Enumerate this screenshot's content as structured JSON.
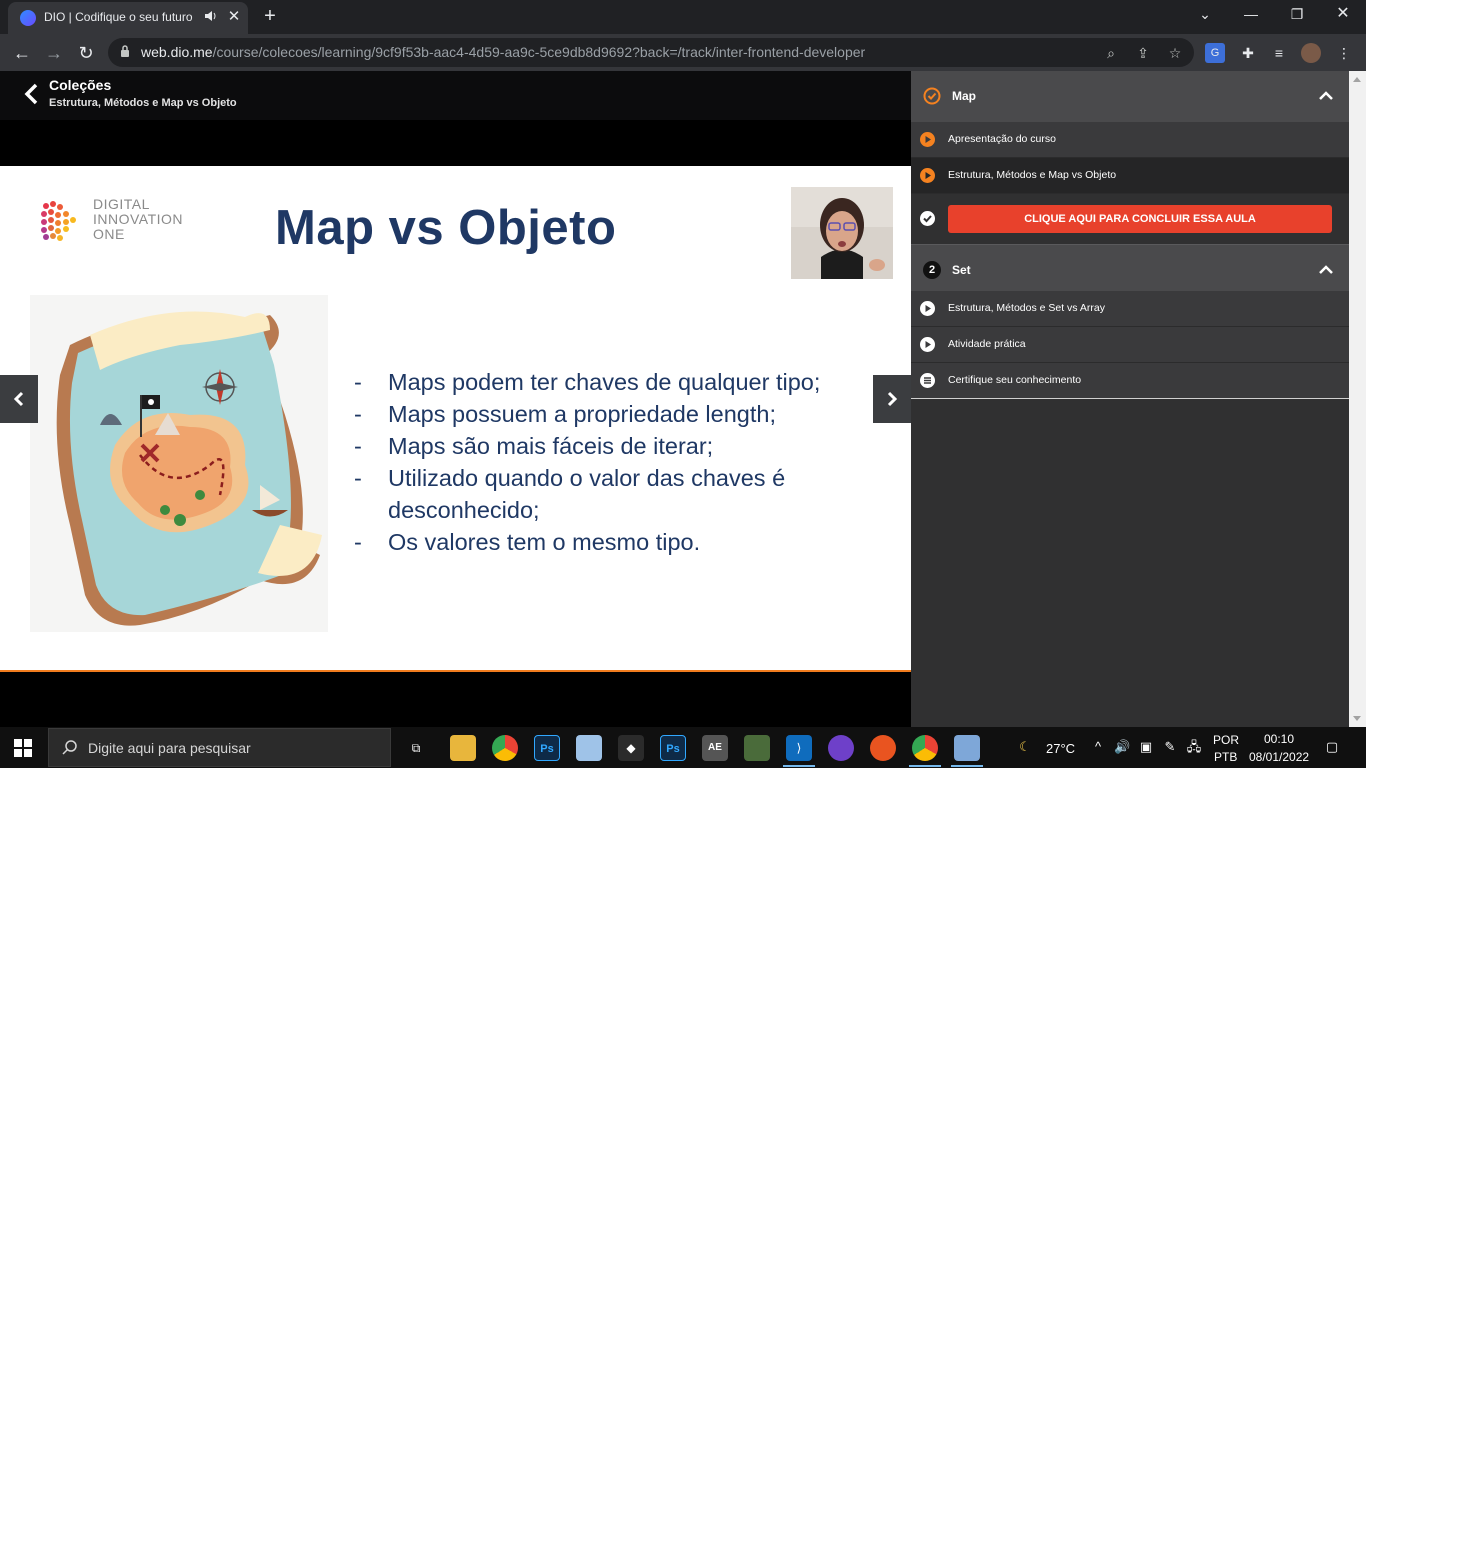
{
  "browser": {
    "tab_title": "DIO | Codifique o seu futuro",
    "url_host": "web.dio.me",
    "url_path": "/course/colecoes/learning/9cf9f53b-aac4-4d59-aa9c-5ce9db8d9692?back=/track/inter-frontend-developer"
  },
  "course_header": {
    "title": "Coleções",
    "subtitle": "Estrutura, Métodos e Map vs Objeto"
  },
  "slide": {
    "brand_lines": [
      "DIGITAL",
      "INNOVATION",
      "ONE"
    ],
    "title": "Map vs Objeto",
    "bullets": [
      "Maps podem ter chaves de qualquer tipo;",
      "Maps possuem a propriedade length;",
      "Maps são mais fáceis de iterar;",
      "Utilizado quando o valor das chaves é desconhecido;",
      "Os valores tem o mesmo tipo."
    ]
  },
  "sidebar": {
    "modules": [
      {
        "marker": "",
        "title": "Map",
        "lessons": [
          {
            "label": "Apresentação do curso",
            "icon": "play-icon"
          },
          {
            "label": "Estrutura, Métodos e Map vs Objeto",
            "icon": "play-icon"
          }
        ],
        "complete_button": "CLIQUE AQUI PARA CONCLUIR ESSA AULA"
      },
      {
        "marker": "2",
        "title": "Set",
        "lessons": [
          {
            "label": "Estrutura, Métodos e Set vs Array",
            "icon": "play-icon"
          },
          {
            "label": "Atividade prática",
            "icon": "play-icon"
          },
          {
            "label": "Certifique seu conhecimento",
            "icon": "list-icon"
          }
        ]
      }
    ]
  },
  "taskbar": {
    "search_placeholder": "Digite aqui para pesquisar",
    "weather": "27°C",
    "lang_top": "POR",
    "lang_bottom": "PTB",
    "time": "00:10",
    "date": "08/01/2022"
  },
  "colors": {
    "accent_orange": "#f58220",
    "complete_button": "#e8412c",
    "slide_title": "#1f3864"
  }
}
